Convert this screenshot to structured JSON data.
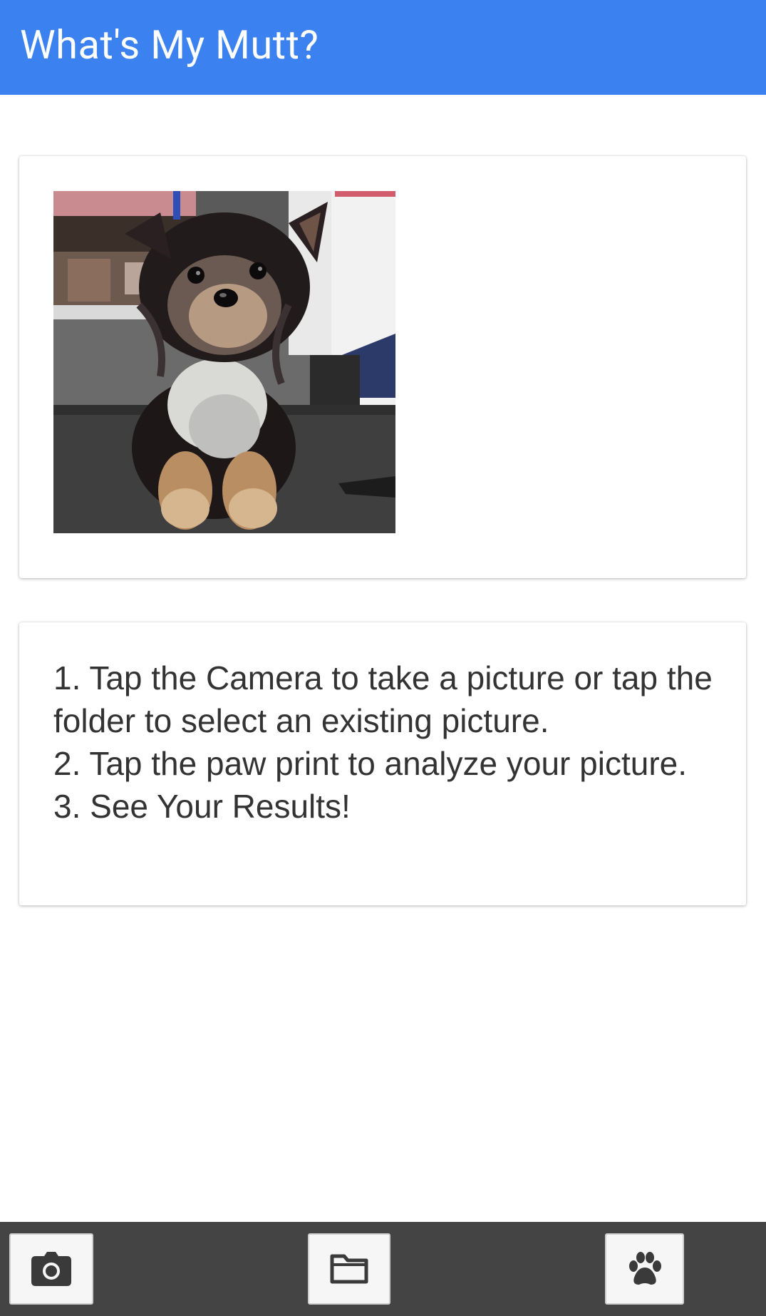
{
  "app_bar": {
    "title": "What's My Mutt?",
    "color": "#3b82f0"
  },
  "photo_card": {
    "image_alt": "Photo of a small fluffy black, white and tan puppy sitting on a grooming table"
  },
  "instructions": {
    "lines": [
      "1. Tap the Camera to take a picture or tap the folder to select an existing picture.",
      "2. Tap the paw print to analyze your picture.",
      "3. See Your Results!"
    ]
  },
  "toolbar": {
    "background": "#444444",
    "buttons": [
      {
        "name": "camera",
        "icon": "camera-icon"
      },
      {
        "name": "folder",
        "icon": "folder-icon"
      },
      {
        "name": "paw",
        "icon": "paw-icon"
      }
    ]
  }
}
